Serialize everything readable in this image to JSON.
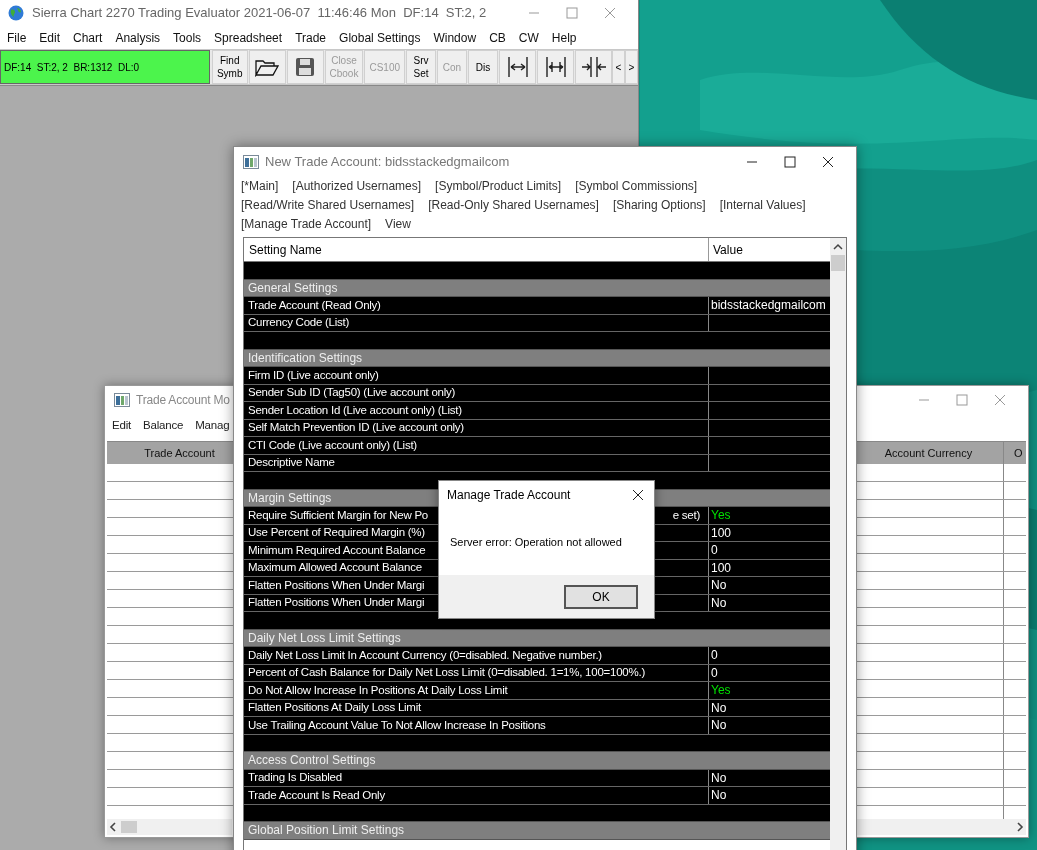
{
  "main_window": {
    "title": "Sierra Chart 2270 Trading Evaluator 2021-06-07  11:46:46 Mon  DF:14  ST:2, 2",
    "menu": [
      "File",
      "Edit",
      "Chart",
      "Analysis",
      "Tools",
      "Spreadsheet",
      "Trade",
      "Global Settings",
      "Window",
      "CB",
      "CW",
      "Help"
    ],
    "status": "DF:14  ST:2, 2  BR:1312  DL:0",
    "toolbar": [
      {
        "kind": "text",
        "lines": [
          "Find",
          "Symb"
        ],
        "disabled": false
      },
      {
        "kind": "open"
      },
      {
        "kind": "save"
      },
      {
        "kind": "text",
        "lines": [
          "Close",
          "Cbook"
        ],
        "disabled": true
      },
      {
        "kind": "text",
        "lines": [
          "CS100"
        ],
        "disabled": true
      },
      {
        "kind": "text",
        "lines": [
          "Srv",
          "Set"
        ],
        "disabled": false
      },
      {
        "kind": "text",
        "lines": [
          "Con"
        ],
        "disabled": true
      },
      {
        "kind": "text",
        "lines": [
          "Dis"
        ],
        "disabled": false
      },
      {
        "kind": "expand"
      },
      {
        "kind": "widen"
      },
      {
        "kind": "shrink"
      }
    ],
    "nav": [
      "<",
      ">"
    ]
  },
  "monitor_window": {
    "title": "Trade Account Mo",
    "menu": [
      "Edit",
      "Balance",
      "Manag"
    ],
    "columns": [
      "Trade Account",
      "Account Currency",
      "O"
    ]
  },
  "settings_window": {
    "title": "New Trade Account: bidsstackedgmailcom",
    "tab_lines": [
      [
        "[*Main]",
        "[Authorized Usernames]",
        "[Symbol/Product Limits]",
        "[Symbol Commissions]"
      ],
      [
        "[Read/Write Shared Usernames]",
        "[Read-Only Shared Usernames]",
        "[Sharing Options]",
        "[Internal Values]"
      ],
      [
        "[Manage Trade Account]",
        "View"
      ]
    ],
    "columns": [
      "Setting Name",
      "Value"
    ],
    "rows": [
      {
        "kind": "blank"
      },
      {
        "kind": "section",
        "name": "General Settings"
      },
      {
        "kind": "setting",
        "name": "Trade Account (Read Only)",
        "value": "bidsstackedgmailcom"
      },
      {
        "kind": "setting",
        "name": "Currency Code (List)"
      },
      {
        "kind": "blank"
      },
      {
        "kind": "section",
        "name": "Identification Settings"
      },
      {
        "kind": "setting",
        "name": "Firm ID (Live account only)"
      },
      {
        "kind": "setting",
        "name": "Sender Sub ID (Tag50) (Live account only)"
      },
      {
        "kind": "setting",
        "name": "Sender Location Id (Live account only) (List)"
      },
      {
        "kind": "setting",
        "name": "Self Match Prevention ID (Live account only)"
      },
      {
        "kind": "setting",
        "name": "CTI Code (Live account only) (List)"
      },
      {
        "kind": "setting",
        "name": "Descriptive Name"
      },
      {
        "kind": "blank"
      },
      {
        "kind": "section",
        "name": "Margin Settings"
      },
      {
        "kind": "setting",
        "name": "Require Sufficient Margin for New Po",
        "tail": "e set)",
        "value": "Yes",
        "color": "#00e000"
      },
      {
        "kind": "setting",
        "name": "Use Percent of Required Margin (%)",
        "value": "100"
      },
      {
        "kind": "setting",
        "name": "Minimum Required Account Balance",
        "value": "0"
      },
      {
        "kind": "setting",
        "name": "Maximum Allowed Account Balance",
        "value": "100"
      },
      {
        "kind": "setting",
        "name": "Flatten Positions When Under Margi",
        "value": "No"
      },
      {
        "kind": "setting",
        "name": "Flatten Positions When Under Margi",
        "value": "No"
      },
      {
        "kind": "blank"
      },
      {
        "kind": "section",
        "name": "Daily Net Loss Limit Settings"
      },
      {
        "kind": "setting",
        "name": "Daily Net Loss Limit In Account Currency (0=disabled. Negative number.)",
        "value": "0"
      },
      {
        "kind": "setting",
        "name": "Percent of Cash Balance for Daily Net Loss Limit (0=disabled. 1=1%, 100=100%.)",
        "value": "0"
      },
      {
        "kind": "setting",
        "name": "Do Not Allow Increase In Positions At Daily Loss Limit",
        "value": "Yes",
        "color": "#00e000"
      },
      {
        "kind": "setting",
        "name": "Flatten Positions At Daily Loss Limit",
        "value": "No"
      },
      {
        "kind": "setting",
        "name": "Use Trailing Account Value To Not Allow Increase In Positions",
        "value": "No"
      },
      {
        "kind": "blank"
      },
      {
        "kind": "section",
        "name": "Access Control Settings"
      },
      {
        "kind": "setting",
        "name": "Trading Is Disabled",
        "value": "No"
      },
      {
        "kind": "setting",
        "name": "Trade Account Is Read Only",
        "value": "No"
      },
      {
        "kind": "blank"
      },
      {
        "kind": "section",
        "name": "Global Position Limit Settings"
      }
    ]
  },
  "dialog": {
    "title": "Manage Trade Account",
    "message": "Server error: Operation not allowed",
    "button": "OK"
  }
}
